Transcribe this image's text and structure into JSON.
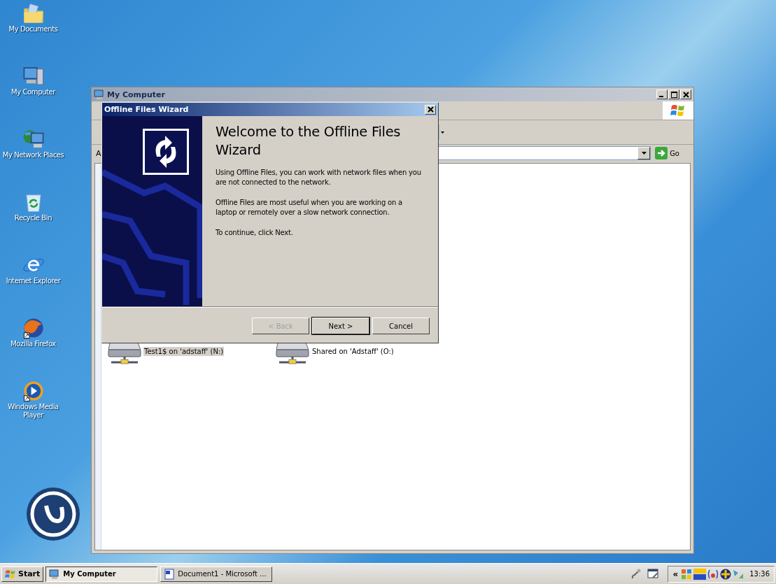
{
  "desktop": {
    "icons": [
      {
        "kind": "documents",
        "label": "My Documents"
      },
      {
        "kind": "computer",
        "label": "My Computer"
      },
      {
        "kind": "network",
        "label": "My Network Places"
      },
      {
        "kind": "recycle",
        "label": "Recycle Bin"
      },
      {
        "kind": "browser",
        "label": "Internet Explorer"
      },
      {
        "kind": "firefox",
        "label": "Mozilla Firefox"
      },
      {
        "kind": "media",
        "label": "Windows Media Player"
      }
    ]
  },
  "explorer_window": {
    "title": "My Computer",
    "address_label": "A",
    "go_label": "Go",
    "drives": [
      {
        "label": "Test1$ on 'adstaff' (N:)",
        "selected": true
      },
      {
        "label": "Shared on 'Adstaff' (O:)",
        "selected": false
      }
    ]
  },
  "wizard": {
    "title": "Offline Files Wizard",
    "heading": "Welcome to the Offline Files Wizard",
    "paragraphs": [
      "Using Offline Files, you can work with network files when you are not connected to the network.",
      "Offline Files are most useful when you are working on a laptop or remotely over a slow network connection.",
      "To continue, click Next."
    ],
    "buttons": [
      {
        "label": "< Back",
        "disabled": true,
        "default": false
      },
      {
        "label": "Next >",
        "disabled": false,
        "default": true
      },
      {
        "label": "Cancel",
        "disabled": false,
        "default": false
      }
    ]
  },
  "taskbar": {
    "start_label": "Start",
    "tasks": [
      {
        "label": "My Computer",
        "selected": true
      },
      {
        "label": "Document1 - Microsoft ...",
        "selected": false
      }
    ],
    "tray_expand": "«",
    "clock": "13:36"
  }
}
